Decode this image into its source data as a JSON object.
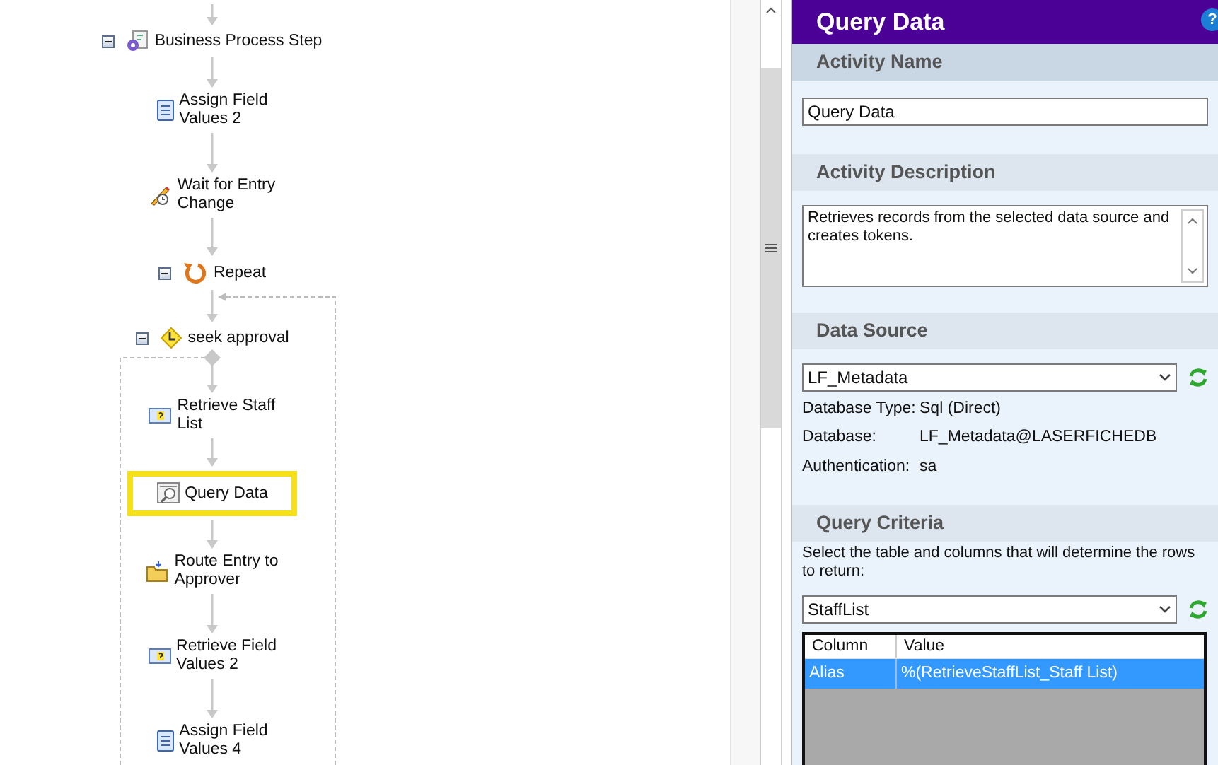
{
  "flow": {
    "nodes": [
      {
        "label": "Business Process Step",
        "kind": "process",
        "expanded": true,
        "highlighted": false
      },
      {
        "label": "Assign Field\nValues 2",
        "kind": "assign",
        "highlighted": false
      },
      {
        "label": "Wait for Entry\nChange",
        "kind": "wait",
        "highlighted": false
      },
      {
        "label": "Repeat",
        "kind": "repeat",
        "expanded": true,
        "highlighted": false
      },
      {
        "label": "seek approval",
        "kind": "approval",
        "expanded": true,
        "highlighted": false
      },
      {
        "label": "Retrieve Staff\nList",
        "kind": "retrieve",
        "highlighted": false
      },
      {
        "label": "Query Data",
        "kind": "query",
        "highlighted": true
      },
      {
        "label": "Route Entry to\nApprover",
        "kind": "route",
        "highlighted": false
      },
      {
        "label": "Retrieve Field\nValues 2",
        "kind": "retrieve",
        "highlighted": false
      },
      {
        "label": "Assign Field\nValues 4",
        "kind": "assign",
        "highlighted": false
      }
    ]
  },
  "panel": {
    "title": "Query Data",
    "help": "?",
    "sections": [
      {
        "kind": "name",
        "heading": "Activity Name",
        "focused": true,
        "value": "Query Data"
      },
      {
        "kind": "description",
        "heading": "Activity Description",
        "focused": false,
        "value": "Retrieves records from the selected data source and creates tokens."
      },
      {
        "kind": "source",
        "heading": "Data Source",
        "focused": false,
        "selected": "LF_Metadata",
        "details": [
          {
            "label": "Database Type:",
            "value": "Sql (Direct)"
          },
          {
            "label": "Database:",
            "value": "LF_Metadata@LASERFICHEDB"
          },
          {
            "label": "Authentication:",
            "value": "sa"
          }
        ]
      },
      {
        "kind": "criteria",
        "heading": "Query Criteria",
        "focused": false,
        "instruction": "Select the table and columns that will determine the rows to return:",
        "selected": "StaffList",
        "table": {
          "columns": [
            "Column",
            "Value"
          ],
          "rows": [
            {
              "cells": [
                "Alias",
                "%(RetrieveStaffList_Staff List)"
              ],
              "selected": true
            }
          ]
        }
      }
    ]
  }
}
